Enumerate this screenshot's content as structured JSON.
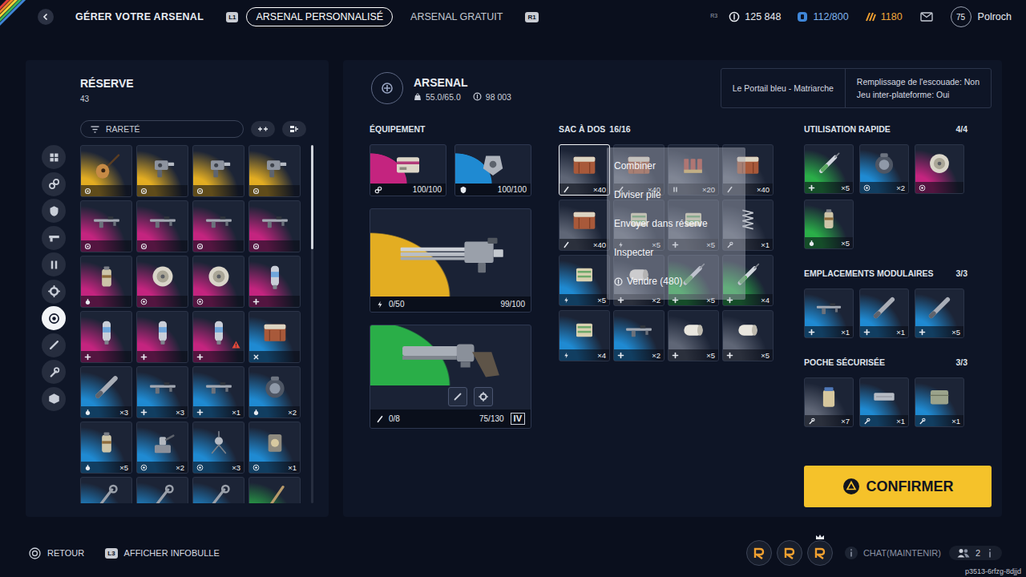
{
  "topbar": {
    "title": "GÉRER VOTRE ARSENAL",
    "prev_key": "L1",
    "next_key": "R1",
    "tabs": [
      {
        "label": "ARSENAL PERSONNALISÉ",
        "selected": true
      },
      {
        "label": "ARSENAL GRATUIT",
        "selected": false
      }
    ],
    "stick_key": "R3",
    "currencies": [
      {
        "kind": "coins",
        "value": "125 848"
      },
      {
        "kind": "tokens",
        "value": "112/800"
      },
      {
        "kind": "raider",
        "value": "1180"
      }
    ],
    "level": "75",
    "player": "Polroch"
  },
  "reserve": {
    "title": "RÉSERVE",
    "count": "43",
    "filter": "RARETÉ",
    "categories": [
      {
        "kind": "grid",
        "selected": false
      },
      {
        "kind": "attach",
        "selected": false
      },
      {
        "kind": "shield",
        "selected": false
      },
      {
        "kind": "gun",
        "selected": false
      },
      {
        "kind": "stack",
        "selected": false
      },
      {
        "kind": "gear",
        "selected": false
      },
      {
        "kind": "target",
        "selected": true
      },
      {
        "kind": "barrel",
        "selected": false
      },
      {
        "kind": "tool",
        "selected": false
      },
      {
        "kind": "box",
        "selected": false
      }
    ],
    "items": [
      {
        "kind": "guitar",
        "rarity": "legendary",
        "tag": "mod",
        "warning": false
      },
      {
        "kind": "gadget",
        "rarity": "legendary",
        "tag": "mod",
        "warning": false
      },
      {
        "kind": "gadget",
        "rarity": "legendary",
        "tag": "mod",
        "warning": false
      },
      {
        "kind": "gadget",
        "rarity": "legendary",
        "tag": "mod",
        "warning": false
      },
      {
        "kind": "rifle",
        "rarity": "epic",
        "tag": "mod",
        "warning": false
      },
      {
        "kind": "rifle",
        "rarity": "epic",
        "tag": "mod",
        "warning": false
      },
      {
        "kind": "rifle",
        "rarity": "epic",
        "tag": "mod",
        "warning": false
      },
      {
        "kind": "rifle",
        "rarity": "epic",
        "tag": "mod",
        "warning": false
      },
      {
        "kind": "canister",
        "rarity": "epic",
        "tag": "throw",
        "warning": false
      },
      {
        "kind": "mine",
        "rarity": "epic",
        "tag": "target",
        "warning": false
      },
      {
        "kind": "mine",
        "rarity": "epic",
        "tag": "target",
        "warning": false
      },
      {
        "kind": "stim",
        "rarity": "epic",
        "tag": "heal",
        "warning": false
      },
      {
        "kind": "stim",
        "rarity": "epic",
        "tag": "heal",
        "warning": false
      },
      {
        "kind": "stim",
        "rarity": "epic",
        "tag": "heal",
        "warning": false
      },
      {
        "kind": "stim",
        "rarity": "epic",
        "tag": "heal",
        "warning": true
      },
      {
        "kind": "crate",
        "rarity": "rare",
        "tag": "trap",
        "warning": false
      },
      {
        "kind": "tube",
        "rarity": "rare",
        "tag": "throw",
        "count": "×3",
        "warning": false
      },
      {
        "kind": "rifle",
        "rarity": "rare",
        "tag": "heal",
        "count": "×3",
        "warning": false
      },
      {
        "kind": "rifle",
        "rarity": "rare",
        "tag": "heal",
        "count": "×1",
        "warning": false
      },
      {
        "kind": "pack",
        "rarity": "rare",
        "tag": "throw",
        "count": "×2",
        "warning": false
      },
      {
        "kind": "canister",
        "rarity": "rare",
        "tag": "throw",
        "count": "×5",
        "warning": false
      },
      {
        "kind": "turret",
        "rarity": "rare",
        "tag": "target",
        "count": "×2",
        "warning": false
      },
      {
        "kind": "drone",
        "rarity": "rare",
        "tag": "target",
        "count": "×3",
        "warning": false
      },
      {
        "kind": "device",
        "rarity": "rare",
        "tag": "target",
        "count": "×1",
        "warning": false
      },
      {
        "kind": "tool",
        "rarity": "rare",
        "warning": false
      },
      {
        "kind": "tool",
        "rarity": "rare",
        "warning": false
      },
      {
        "kind": "tool",
        "rarity": "rare",
        "warning": false
      },
      {
        "kind": "stick",
        "rarity": "uncommon",
        "warning": false
      }
    ]
  },
  "arsenal": {
    "title": "ARSENAL",
    "weight": "55.0/65.0",
    "value": "98 003",
    "map": "Le Portail bleu - Matriarche",
    "settings": [
      "Remplissage de l'escouade: Non",
      "Jeu inter-plateforme: Oui"
    ],
    "equipment": {
      "title": "ÉQUIPEMENT",
      "gear": [
        {
          "kind": "augment",
          "rarity": "epic",
          "tag": "attach",
          "durability": "100/100"
        },
        {
          "kind": "shieldpack",
          "rarity": "rare",
          "tag": "shield",
          "durability": "100/100"
        }
      ],
      "weapons": [
        {
          "kind": "minigun",
          "rarity": "legendary",
          "tag": "energy",
          "ammo": "0/50",
          "durability": "99/100",
          "slots": []
        },
        {
          "kind": "revolver",
          "rarity": "uncommon",
          "tag": "ammo",
          "ammo": "0/8",
          "durability": "75/130",
          "tier": "IV",
          "slots": [
            {
              "kind": "barrel"
            },
            {
              "kind": "gear"
            }
          ]
        }
      ]
    },
    "backpack": {
      "title": "SAC À DOS",
      "capacity": "16/16",
      "items": [
        {
          "kind": "crate",
          "rarity": "common",
          "tag": "ammo",
          "count": "×40",
          "selected": true
        },
        {
          "kind": "crate",
          "rarity": "common",
          "tag": "ammo",
          "count": "×40",
          "selected": false
        },
        {
          "kind": "shells",
          "rarity": "common",
          "tag": "stack",
          "count": "×20",
          "selected": false
        },
        {
          "kind": "crate",
          "rarity": "common",
          "tag": "ammo",
          "count": "×40",
          "selected": false
        },
        {
          "kind": "crate",
          "rarity": "common",
          "tag": "ammo",
          "count": "×40",
          "selected": false
        },
        {
          "kind": "battery",
          "rarity": "common",
          "tag": "energy",
          "count": "×5",
          "selected": false
        },
        {
          "kind": "battery",
          "rarity": "common",
          "tag": "heal",
          "count": "×5",
          "selected": false
        },
        {
          "kind": "spring",
          "rarity": "common",
          "tag": "tool",
          "count": "×1",
          "selected": false
        },
        {
          "kind": "battery",
          "rarity": "rare",
          "tag": "energy",
          "count": "×5",
          "selected": false
        },
        {
          "kind": "bandage",
          "rarity": "common",
          "tag": "heal",
          "count": "×2",
          "selected": false
        },
        {
          "kind": "syringe",
          "rarity": "uncommon",
          "tag": "heal",
          "count": "×5",
          "selected": false
        },
        {
          "kind": "syringe",
          "rarity": "uncommon",
          "tag": "heal",
          "count": "×4",
          "selected": false
        },
        {
          "kind": "battery",
          "rarity": "rare",
          "tag": "energy",
          "count": "×4",
          "selected": false
        },
        {
          "kind": "rifle",
          "rarity": "rare",
          "tag": "heal",
          "count": "×2",
          "selected": false
        },
        {
          "kind": "bandage",
          "rarity": "common",
          "tag": "heal",
          "count": "×5",
          "selected": false
        },
        {
          "kind": "bandage",
          "rarity": "common",
          "tag": "heal",
          "count": "×5",
          "selected": false
        }
      ]
    },
    "menu": [
      {
        "label": "Combiner",
        "kind": "action"
      },
      {
        "label": "Diviser pile",
        "kind": "action"
      },
      {
        "label": "Envoyer dans réserve",
        "kind": "action"
      },
      {
        "label": "Inspecter",
        "kind": "action"
      },
      {
        "label": "Vendre (480)",
        "kind": "sell"
      }
    ],
    "sections": [
      {
        "title": "UTILISATION RAPIDE",
        "capacity": "4/4",
        "items": [
          {
            "kind": "syringe",
            "rarity": "uncommon",
            "tag": "heal",
            "count": "×5"
          },
          {
            "kind": "pack",
            "rarity": "rare",
            "tag": "target",
            "count": "×2"
          },
          {
            "kind": "mine",
            "rarity": "epic",
            "tag": "target"
          },
          {
            "kind": "canister",
            "rarity": "uncommon",
            "tag": "throw",
            "count": "×5"
          }
        ]
      },
      {
        "title": "EMPLACEMENTS MODULAIRES",
        "capacity": "3/3",
        "items": [
          {
            "kind": "rifle",
            "rarity": "rare",
            "tag": "heal",
            "count": "×1"
          },
          {
            "kind": "tube",
            "rarity": "rare",
            "tag": "heal",
            "count": "×1"
          },
          {
            "kind": "tube",
            "rarity": "rare",
            "tag": "heal",
            "count": "×5"
          }
        ]
      },
      {
        "title": "POCHE SÉCURISÉE",
        "capacity": "3/3",
        "items": [
          {
            "kind": "jar",
            "rarity": "common",
            "tag": "tool",
            "count": "×7"
          },
          {
            "kind": "box",
            "rarity": "rare",
            "tag": "tool",
            "count": "×1"
          },
          {
            "kind": "bag",
            "rarity": "rare",
            "tag": "tool",
            "count": "×1"
          }
        ]
      }
    ],
    "confirm": "CONFIRMER"
  },
  "bottombar": {
    "back": "RETOUR",
    "tooltip_key": "L3",
    "tooltip": "AFFICHER INFOBULLE",
    "friends": [
      {
        "crown": false
      },
      {
        "crown": false
      },
      {
        "crown": true
      }
    ],
    "chat": "CHAT(MAINTENIR)",
    "party": "2",
    "code": "p3513-6rfzg-8djjd"
  }
}
